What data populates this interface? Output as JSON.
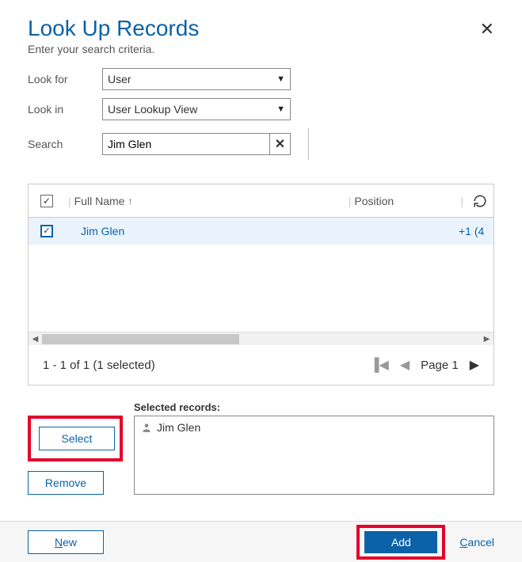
{
  "header": {
    "title": "Look Up Records",
    "subtitle": "Enter your search criteria.",
    "close_icon": "✕"
  },
  "form": {
    "look_for_label": "Look for",
    "look_for_value": "User",
    "look_in_label": "Look in",
    "look_in_value": "User Lookup View",
    "search_label": "Search",
    "search_value": "Jim Glen"
  },
  "grid": {
    "columns": {
      "full_name": "Full Name",
      "position": "Position"
    },
    "sort_arrow": "↑",
    "rows": [
      {
        "full_name": "Jim Glen",
        "position": "",
        "phone_partial": "+1 (4"
      }
    ]
  },
  "pager": {
    "summary": "1 - 1 of 1 (1 selected)",
    "page_label": "Page 1"
  },
  "selected": {
    "label": "Selected records:",
    "items": [
      {
        "name": "Jim Glen"
      }
    ]
  },
  "buttons": {
    "select": "Select",
    "remove": "Remove",
    "new": "New",
    "add": "Add",
    "cancel": "Cancel"
  }
}
